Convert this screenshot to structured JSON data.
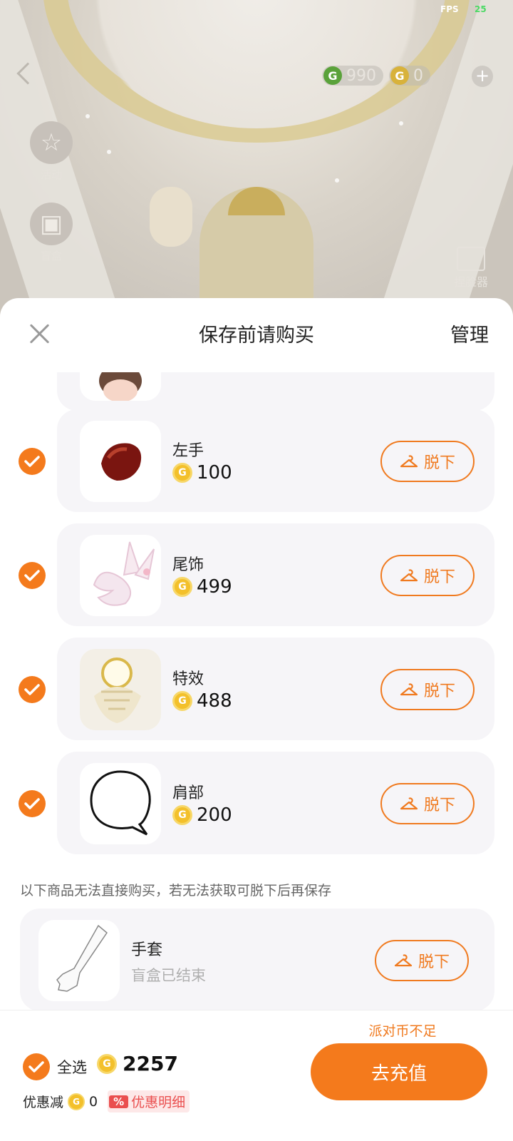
{
  "status": {
    "fps_label": "FPS",
    "fps_value": "25"
  },
  "scene": {
    "currency_green_value": "990",
    "currency_gold_value": "0",
    "side_items": [
      "活动",
      "盲盒"
    ],
    "right_item": "捏脸器"
  },
  "sheet": {
    "title": "保存前请购买",
    "manage_label": "管理",
    "items": [
      {
        "name": "左手",
        "price": "100",
        "action": "脱下",
        "checked": true
      },
      {
        "name": "尾饰",
        "price": "499",
        "action": "脱下",
        "checked": true
      },
      {
        "name": "特效",
        "price": "488",
        "action": "脱下",
        "checked": true
      },
      {
        "name": "肩部",
        "price": "200",
        "action": "脱下",
        "checked": true
      }
    ],
    "unpurchasable_note": "以下商品无法直接购买，若无法获取可脱下后再保存",
    "unpurchasable_items": [
      {
        "name": "手套",
        "status": "盲盒已结束",
        "action": "脱下"
      }
    ]
  },
  "footer": {
    "insufficient_text": "派对币不足",
    "select_all_label": "全选",
    "total": "2257",
    "discount_label": "优惠减",
    "discount_value": "0",
    "detail_badge_icon": "%",
    "detail_label": "优惠明细",
    "recharge_label": "去充值"
  },
  "colors": {
    "accent": "#f47a1c",
    "coin": "#f3c02b",
    "discount_red": "#ea4f4f"
  }
}
